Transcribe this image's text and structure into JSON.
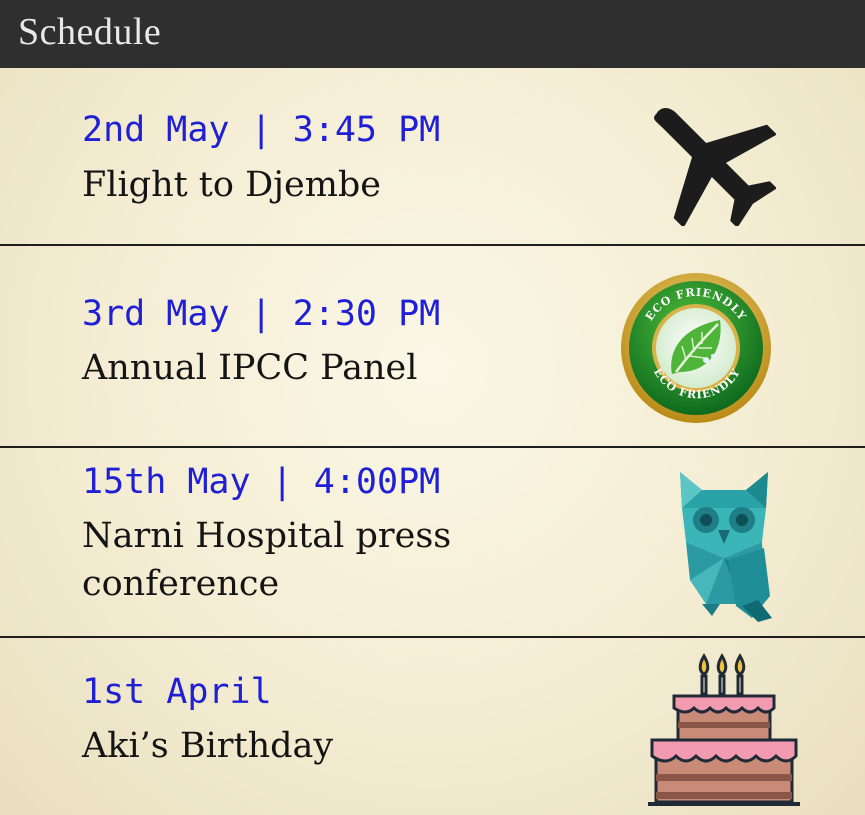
{
  "app": {
    "title": "Schedule"
  },
  "events": [
    {
      "when": "2nd May | 3:45 PM",
      "title": "Flight to Djembe",
      "icon": "airplane-icon"
    },
    {
      "when": "3rd May | 2:30 PM",
      "title": "Annual IPCC Panel",
      "icon": "eco-friendly-leaf-badge-icon"
    },
    {
      "when": "15th May | 4:00PM",
      "title": "Narni Hospital press conference",
      "icon": "owl-icon"
    },
    {
      "when": "1st April",
      "title": "Aki’s Birthday",
      "icon": "birthday-cake-icon"
    }
  ],
  "badge": {
    "top_text": "ECO FRIENDLY",
    "bottom_text": "ECO FRIENDLY"
  },
  "colors": {
    "titlebar": "#2f2f2f",
    "title_text": "#e9e9e9",
    "date_text": "#1f1fd6",
    "event_text": "#141414",
    "separator": "#1e1e1e",
    "paper": "#f4edd3"
  }
}
